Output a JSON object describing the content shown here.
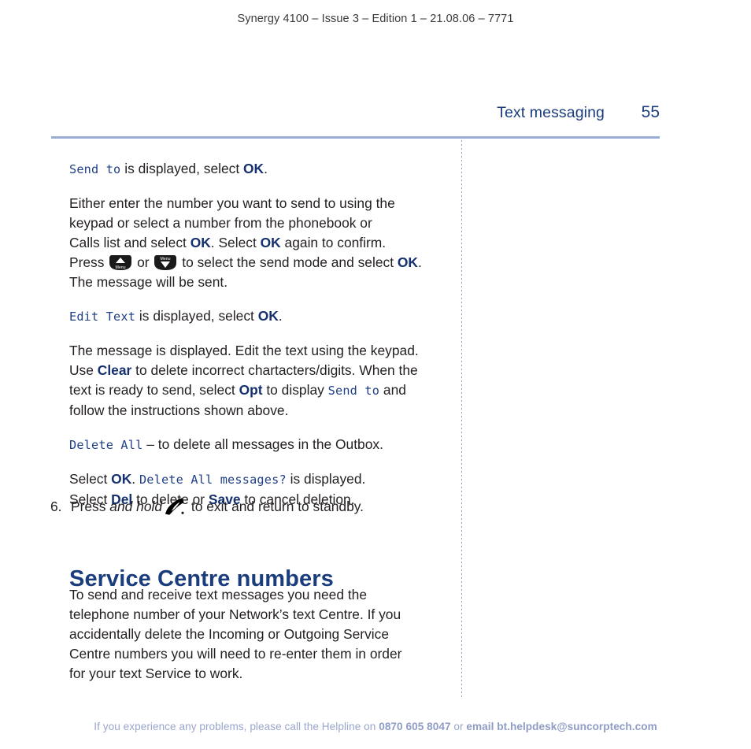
{
  "running_head": "Synergy 4100 – Issue 3 – Edition 1 – 21.08.06 – 7771",
  "chapter": {
    "title": "Text messaging",
    "page_number": "55"
  },
  "body": {
    "p1": {
      "lcd_send_to": "Send to",
      "rest_a": " is displayed, select ",
      "ok": "OK",
      "rest_b": "."
    },
    "p2": {
      "line1": "Either enter the number you want to send to using the",
      "line2": "keypad or select a number from the phonebook or",
      "line3_a": "Calls list and select ",
      "line3_ok1": "OK",
      "line3_b": ". Select ",
      "line3_ok2": "OK",
      "line3_c": " again to confirm.",
      "line4_a": "Press ",
      "line4_b": " or ",
      "line4_c": " to select the send mode and select ",
      "line4_ok": "OK",
      "line4_d": ".",
      "line5": "The message will be sent."
    },
    "p3": {
      "lcd_edit_text": "Edit Text",
      "rest_a": " is displayed, select ",
      "ok": "OK",
      "rest_b": "."
    },
    "p4": {
      "line1": "The message is displayed. Edit the text using the keypad.",
      "line2_a": "Use ",
      "line2_clear": "Clear",
      "line2_b": " to delete incorrect chartacters/digits. When the",
      "line3_a": "text is ready to send, select ",
      "line3_opt": "Opt",
      "line3_b": " to display ",
      "line3_lcd": "Send to",
      "line3_c": " and",
      "line4": "follow the instructions shown above."
    },
    "p5": {
      "lcd_delete_all": "Delete All",
      "rest": " – to delete all messages in the Outbox."
    },
    "p6": {
      "line1_a": "Select ",
      "line1_ok": "OK",
      "line1_b": ". ",
      "line1_lcd": "Delete All messages?",
      "line1_c": " is displayed.",
      "line2_a": "Select ",
      "line2_del": "Del",
      "line2_b": " to delete or ",
      "line2_save": "Save",
      "line2_c": " to cancel deletion."
    },
    "step6": {
      "number": "6.",
      "text_a": "Press ",
      "text_em": "and hold",
      "text_b": " to exit and return to standby."
    },
    "section_heading": "Service Centre numbers",
    "p7": {
      "line1": "To send and receive text messages you need the",
      "line2": "telephone number of your Network’s text Centre. If you",
      "line3": "accidentally delete the Incoming or Outgoing Service",
      "line4": "Centre numbers you will need to re-enter them in order",
      "line5": "for your text Service to work."
    }
  },
  "icons": {
    "menu_up_key_label": "Menu",
    "menu_down_key_label": "Menu",
    "hangup_key": "hangup-key-icon"
  },
  "footer": {
    "part1": "If you experience any problems, please call the Helpline on ",
    "phone": "0870 605 8047",
    "part2": " or ",
    "email": "email bt.helpdesk@suncorptech.com"
  },
  "colors": {
    "heading_blue": "#1b3d7d",
    "bold_blue": "#14306e",
    "lcd_blue": "#1f3f86",
    "rule_blue": "#9bacd4",
    "footer_blue": "#99a6cc"
  }
}
